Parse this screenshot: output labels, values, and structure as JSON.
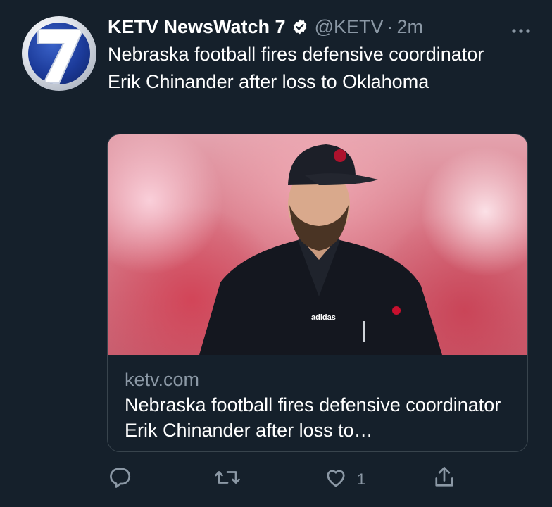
{
  "tweet": {
    "display_name": "KETV NewsWatch 7",
    "handle": "@KETV",
    "separator": "·",
    "time": "2m",
    "text": "Nebraska football fires defensive coordinator Erik Chinander after loss to Oklahoma"
  },
  "avatar": {
    "label": "7",
    "brand_color": "#1c3b9a"
  },
  "card": {
    "domain": "ketv.com",
    "title": "Nebraska football fires defensive coordinator Erik Chinander after loss to…",
    "image_logo_text": "adidas"
  },
  "actions": {
    "reply_icon": "reply-icon",
    "retweet_icon": "retweet-icon",
    "like_icon": "heart-icon",
    "like_count": "1",
    "share_icon": "share-icon"
  },
  "colors": {
    "background": "#15202b",
    "secondary_text": "#8b98a5",
    "verified": "#ffffff"
  }
}
